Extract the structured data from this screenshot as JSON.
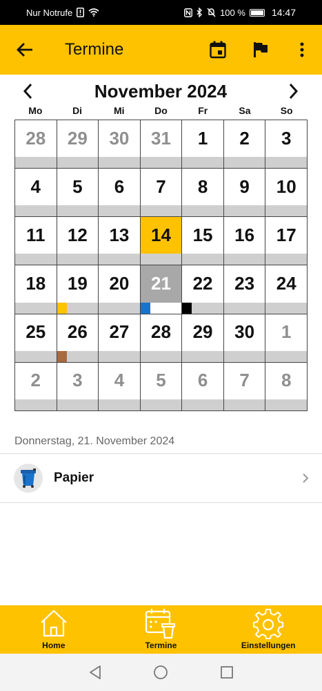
{
  "status": {
    "carrier": "Nur Notrufe",
    "battery": "100 %",
    "time": "14:47"
  },
  "appbar": {
    "title": "Termine",
    "icons": [
      "back-arrow-icon",
      "calendar-today-icon",
      "flag-icon",
      "more-vert-icon"
    ]
  },
  "calendar": {
    "month_title": "November 2024",
    "weekdays": [
      "Mo",
      "Di",
      "Mi",
      "Do",
      "Fr",
      "Sa",
      "So"
    ],
    "today": "14",
    "selected": "21",
    "days": [
      {
        "d": "28",
        "other": true
      },
      {
        "d": "29",
        "other": true
      },
      {
        "d": "30",
        "other": true
      },
      {
        "d": "31",
        "other": true
      },
      {
        "d": "1"
      },
      {
        "d": "2"
      },
      {
        "d": "3"
      },
      {
        "d": "4"
      },
      {
        "d": "5"
      },
      {
        "d": "6"
      },
      {
        "d": "7"
      },
      {
        "d": "8"
      },
      {
        "d": "9"
      },
      {
        "d": "10"
      },
      {
        "d": "11"
      },
      {
        "d": "12"
      },
      {
        "d": "13"
      },
      {
        "d": "14",
        "today": true
      },
      {
        "d": "15"
      },
      {
        "d": "16"
      },
      {
        "d": "17"
      },
      {
        "d": "18"
      },
      {
        "d": "19",
        "mark": "#FFC200"
      },
      {
        "d": "20"
      },
      {
        "d": "21",
        "selected": true,
        "mark": "#1a73c9",
        "white_strip": true
      },
      {
        "d": "22",
        "mark": "#000000"
      },
      {
        "d": "23"
      },
      {
        "d": "24"
      },
      {
        "d": "25"
      },
      {
        "d": "26",
        "mark": "#a86a3f"
      },
      {
        "d": "27"
      },
      {
        "d": "28"
      },
      {
        "d": "29"
      },
      {
        "d": "30"
      },
      {
        "d": "1",
        "other": true
      },
      {
        "d": "2",
        "other": true
      },
      {
        "d": "3",
        "other": true
      },
      {
        "d": "4",
        "other": true
      },
      {
        "d": "5",
        "other": true
      },
      {
        "d": "6",
        "other": true
      },
      {
        "d": "7",
        "other": true
      },
      {
        "d": "8",
        "other": true
      }
    ]
  },
  "detail": {
    "date_label": "Donnerstag, 21. November 2024",
    "items": [
      {
        "label": "Papier",
        "icon": "blue-bin-icon",
        "color": "#1a73c9"
      }
    ]
  },
  "bottom_nav": {
    "tabs": [
      {
        "label": "Home",
        "icon": "home-icon"
      },
      {
        "label": "Termine",
        "icon": "calendar-bin-icon"
      },
      {
        "label": "Einstellungen",
        "icon": "gear-icon"
      }
    ]
  },
  "colors": {
    "accent": "#FFC200",
    "selected_bg": "#a8a8a8",
    "strip": "#cfcfcf"
  }
}
